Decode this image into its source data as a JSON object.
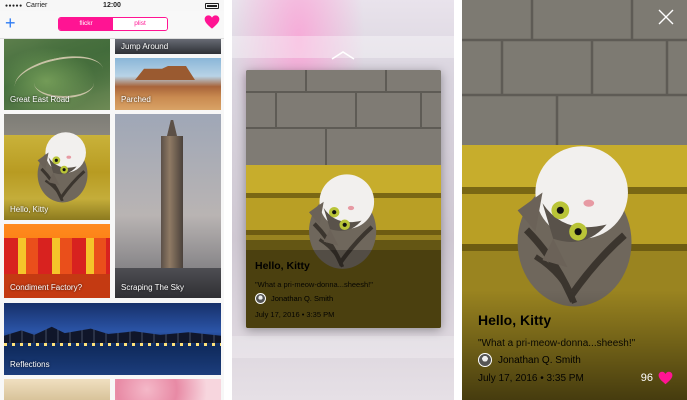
{
  "status_bar": {
    "carrier": "Carrier",
    "time": "12:00"
  },
  "nav": {
    "segments": [
      "flickr",
      "plist"
    ],
    "selected_segment": "flickr",
    "accent_color": "#ff1493",
    "plus_icon": "plus-icon",
    "heart_icon": "heart-icon"
  },
  "grid": {
    "tiles": [
      {
        "caption": "Great East Road"
      },
      {
        "caption": "Jump Around"
      },
      {
        "caption": "Parched"
      },
      {
        "caption": "Hello, Kitty"
      },
      {
        "caption": "Scraping The Sky"
      },
      {
        "caption": "Condiment Factory?"
      },
      {
        "caption": "Reflections"
      }
    ]
  },
  "photo": {
    "title": "Hello, Kitty",
    "quote": "\"What a pri-meow-donna...sheesh!\"",
    "author": "Jonathan Q. Smith",
    "date": "July 17, 2016 • 3:35 PM",
    "likes": "96"
  },
  "icons": {
    "peek_chevron": "chevron-up-icon",
    "close": "close-icon",
    "like": "heart-icon"
  }
}
